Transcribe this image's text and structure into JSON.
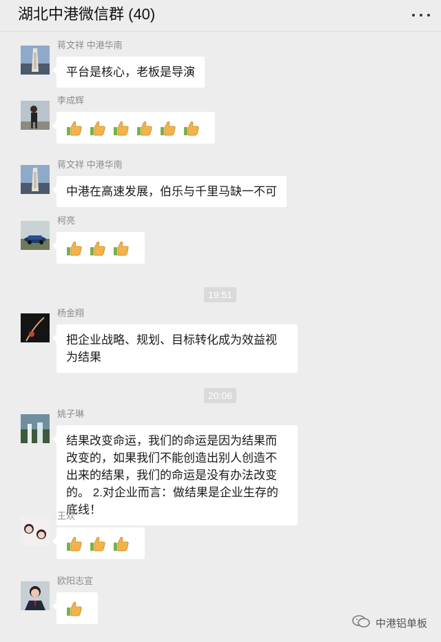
{
  "header": {
    "title": "湖北中港微信群 (40)",
    "more_icon": "more-dots-icon"
  },
  "messages": [
    {
      "sender": "蒋文祥 中港华南",
      "text": "平台是核心，老板是导演",
      "avatar": "tower-photo"
    },
    {
      "sender": "李成辉",
      "thumbs": 6,
      "avatar": "person-photo"
    },
    {
      "sender": "蒋文祥 中港华南",
      "text": "中港在高速发展，伯乐与千里马缺一不可",
      "avatar": "tower-photo"
    },
    {
      "sender": "柯亮",
      "thumbs": 3,
      "avatar": "car-photo"
    },
    {
      "sender": "杨金翔",
      "text": "把企业战略、规划、目标转化成为效益视为结果",
      "avatar": "dark-photo"
    },
    {
      "sender": "姚子琳",
      "text": "结果改变命运，我们的命运是因为结果而改变的，如果我们不能创造出别人创造不出来的结果，我们的命运是没有办法改变的。 2.对企业而言：做结果是企业生存的底线！",
      "avatar": "waterfall-photo"
    },
    {
      "sender": "王欢",
      "thumbs": 3,
      "avatar": "girls-photo"
    },
    {
      "sender": "欧阳志宣",
      "thumbs": 1,
      "avatar": "man-suit-photo"
    }
  ],
  "timestamps": [
    "19:51",
    "20:06"
  ],
  "watermark": {
    "label": "中港铝单板",
    "icon": "wechat-icon"
  },
  "colors": {
    "background": "#ededed",
    "bubble": "#ffffff",
    "thumb": "#f2b34a"
  }
}
